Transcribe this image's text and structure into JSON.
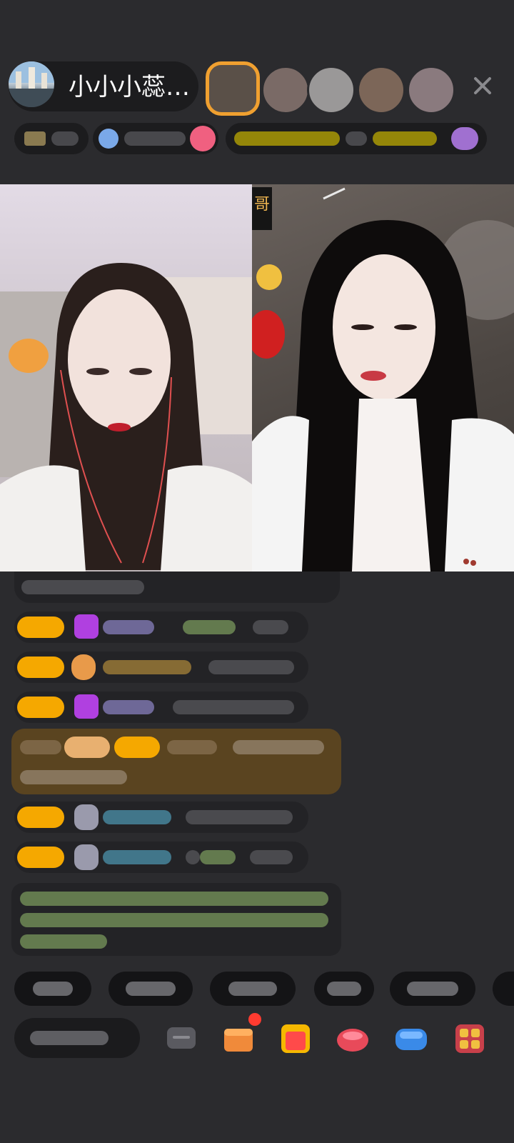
{
  "header": {
    "host_name": "小小小蕊…"
  },
  "video": {
    "right_overlay_text": "哥"
  },
  "colors": {
    "background": "#2b2b2e",
    "badge": "#f5a800",
    "gift_banner": "#5a4420",
    "system_text": "#7fa060",
    "notification_dot": "#ff3b30"
  },
  "icons": {
    "close": "close-icon",
    "toolbar": [
      "chat-icon",
      "gift-box-icon",
      "gift-icon",
      "shop-icon",
      "game-icon",
      "grid-icon"
    ]
  }
}
